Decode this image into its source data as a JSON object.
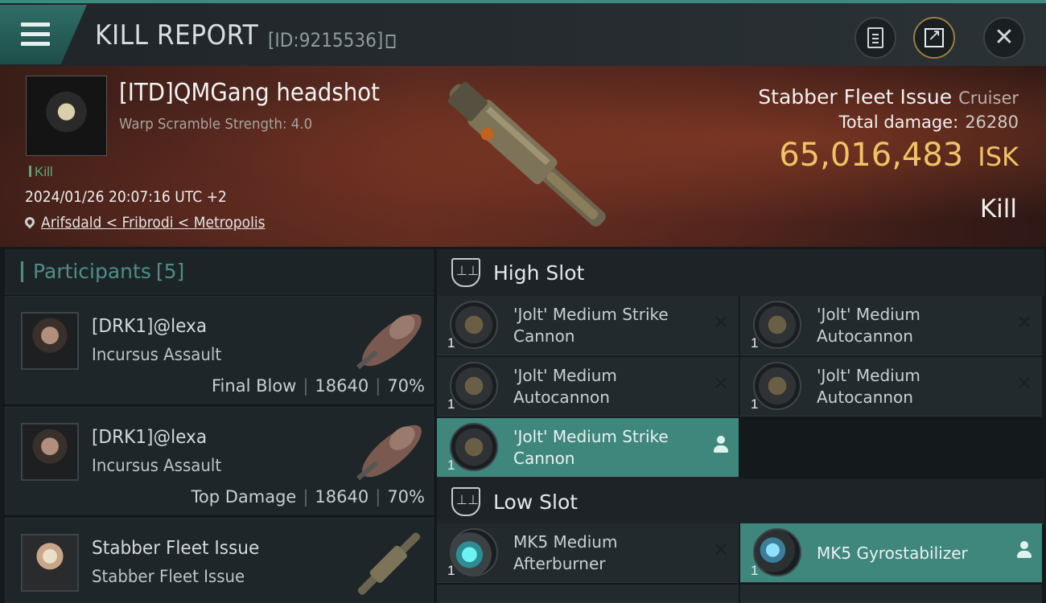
{
  "header": {
    "title": "KILL REPORT",
    "report_id": "[ID:9215536]"
  },
  "victim": {
    "pilot": "[ITD]QMGang headshot",
    "detail": "Warp Scramble Strength: 4.0",
    "tag": "Kill",
    "datetime": "2024/01/26 20:07:16 UTC +2",
    "location": "Arifsdald < Fribrodi < Metropolis",
    "ship": "Stabber Fleet Issue",
    "ship_class": "Cruiser",
    "total_damage_label": "Total damage:",
    "total_damage": "26280",
    "isk_value": "65,016,483",
    "isk_unit": "ISK",
    "result": "Kill"
  },
  "participants": {
    "label": "Participants",
    "count": "[5]",
    "items": [
      {
        "name": "[DRK1]@lexa",
        "ship": "Incursus Assault",
        "role": "Final Blow",
        "damage": "18640",
        "percent": "70%"
      },
      {
        "name": "[DRK1]@lexa",
        "ship": "Incursus Assault",
        "role": "Top Damage",
        "damage": "18640",
        "percent": "70%"
      },
      {
        "name": "Stabber Fleet Issue",
        "ship": "Stabber Fleet Issue",
        "role": "",
        "damage": "",
        "percent": ""
      }
    ]
  },
  "fitting": {
    "high_slot_label": "High Slot",
    "low_slot_label": "Low Slot",
    "high": [
      {
        "line1": "'Jolt' Medium Strike",
        "line2": "Cannon",
        "qty": "1",
        "status": "destroyed"
      },
      {
        "line1": "'Jolt' Medium",
        "line2": "Autocannon",
        "qty": "1",
        "status": "destroyed"
      },
      {
        "line1": "'Jolt' Medium",
        "line2": "Autocannon",
        "qty": "1",
        "status": "destroyed"
      },
      {
        "line1": "'Jolt' Medium",
        "line2": "Autocannon",
        "qty": "1",
        "status": "destroyed"
      },
      {
        "line1": "'Jolt' Medium Strike",
        "line2": "Cannon",
        "qty": "1",
        "status": "dropped"
      }
    ],
    "low": [
      {
        "line1": "MK5 Medium",
        "line2": "Afterburner",
        "qty": "1",
        "status": "destroyed"
      },
      {
        "line1": "MK5 Gyrostabilizer",
        "line2": "",
        "qty": "1",
        "status": "dropped"
      }
    ],
    "status_glyph": "✕"
  },
  "colors": {
    "accent": "#3f867d",
    "isk": "#f2c267",
    "kill_tag": "#63a47a"
  }
}
